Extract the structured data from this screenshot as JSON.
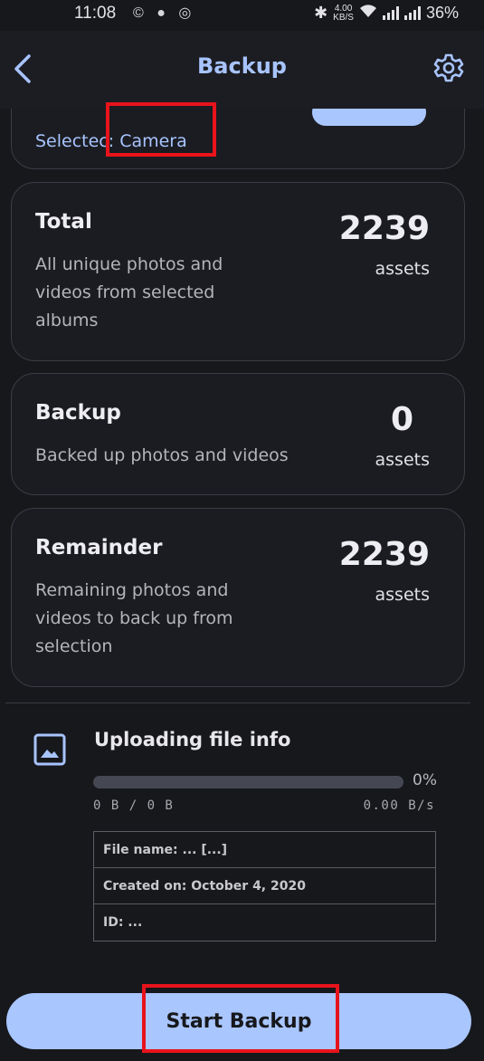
{
  "status_bar": {
    "time": "11:08",
    "app_icons": "© ● ◎",
    "net_speed_value": "4.00",
    "net_speed_unit": "KB/S",
    "battery": "36%"
  },
  "app_bar": {
    "title": "Backup",
    "back_icon": "chevron-left-icon",
    "settings_icon": "gear-icon"
  },
  "albums": {
    "selected_text": "Selectec: Camera"
  },
  "cards": {
    "total": {
      "title": "Total",
      "desc_line1": "All unique photos and",
      "desc_line2": "videos from selected",
      "desc_line3": "albums",
      "count": "2239",
      "unit": "assets"
    },
    "backup": {
      "title": "Backup",
      "desc_line1": "Backed up photos and videos",
      "count": "0",
      "unit": "assets"
    },
    "remainder": {
      "title": "Remainder",
      "desc_line1": "Remaining photos and",
      "desc_line2": "videos to back up from",
      "desc_line3": "selection",
      "count": "2239",
      "unit": "assets"
    }
  },
  "upload": {
    "title": "Uploading file info",
    "progress_percent": 0,
    "progress_label": "0%",
    "bytes": "0 B / 0 B",
    "speed": "0.00 B/s",
    "file_name": "File name: ... [...]",
    "created_on": "Created on: October 4, 2020",
    "id": "ID: ..."
  },
  "actions": {
    "start_backup": "Start Backup"
  },
  "colors": {
    "background": "#17181c",
    "accent": "#a8c4ff",
    "highlight": "#e8131b"
  }
}
